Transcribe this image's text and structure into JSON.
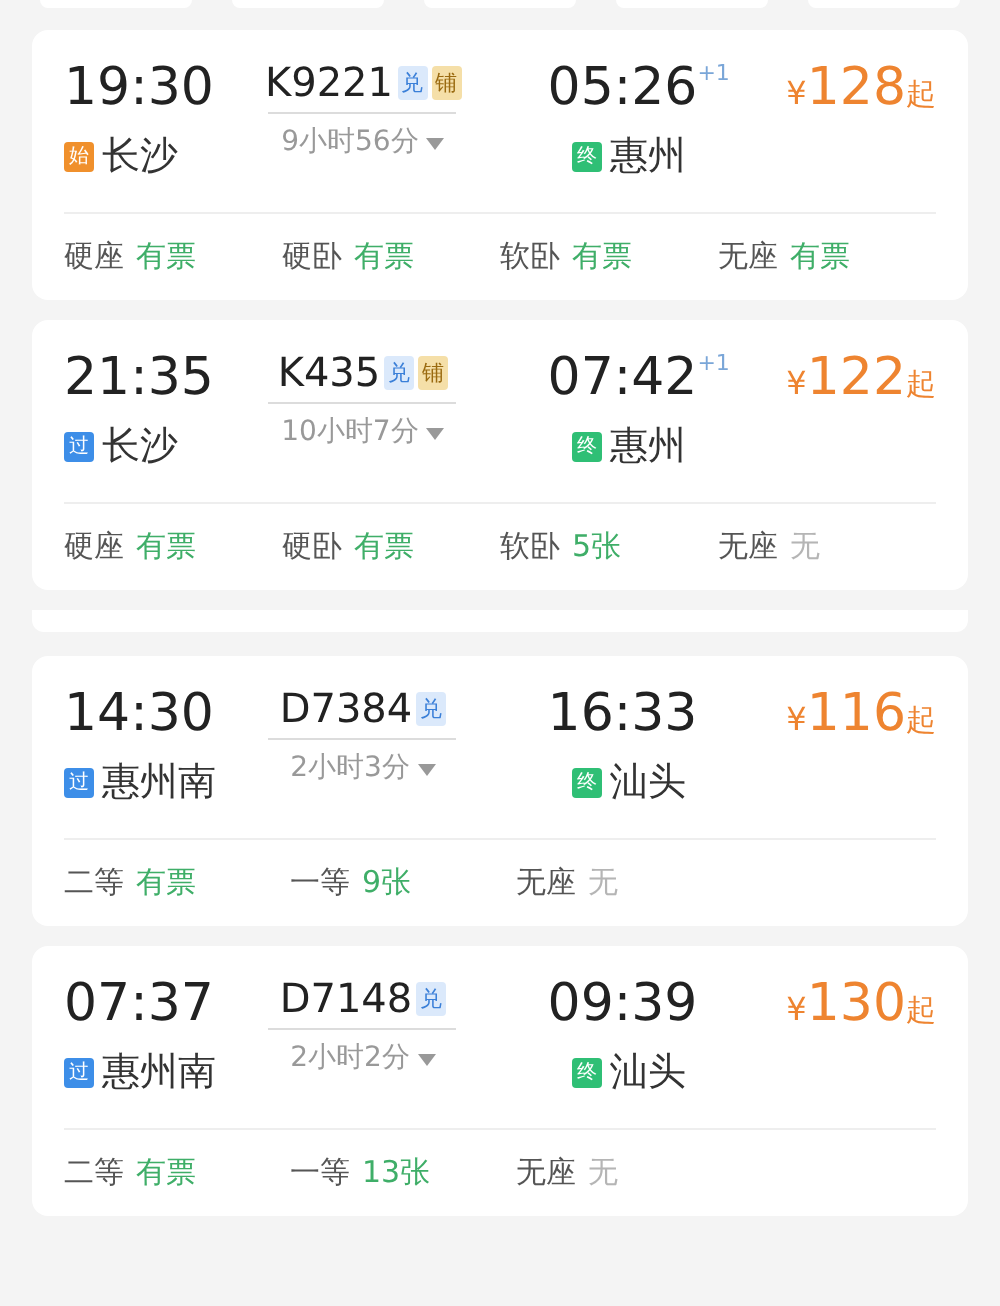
{
  "trains": [
    {
      "depart": "19:30",
      "from": {
        "kind": "start",
        "badge": "始",
        "name": "长沙"
      },
      "number": "K9221",
      "tags": [
        {
          "kind": "exchange",
          "text": "兑"
        },
        {
          "kind": "berth",
          "text": "铺"
        }
      ],
      "duration": "9小时56分",
      "arrive": "05:26",
      "next_day": "+1",
      "to": {
        "kind": "end",
        "badge": "终",
        "name": "惠州"
      },
      "currency": "¥",
      "price": "128",
      "price_suffix": "起",
      "seats": [
        {
          "name": "硬座",
          "status": "有票",
          "kind": "available"
        },
        {
          "name": "硬卧",
          "status": "有票",
          "kind": "available"
        },
        {
          "name": "软卧",
          "status": "有票",
          "kind": "available"
        },
        {
          "name": "无座",
          "status": "有票",
          "kind": "available"
        }
      ]
    },
    {
      "depart": "21:35",
      "from": {
        "kind": "pass",
        "badge": "过",
        "name": "长沙"
      },
      "number": "K435",
      "tags": [
        {
          "kind": "exchange",
          "text": "兑"
        },
        {
          "kind": "berth",
          "text": "铺"
        }
      ],
      "duration": "10小时7分",
      "arrive": "07:42",
      "next_day": "+1",
      "to": {
        "kind": "end",
        "badge": "终",
        "name": "惠州"
      },
      "currency": "¥",
      "price": "122",
      "price_suffix": "起",
      "seats": [
        {
          "name": "硬座",
          "status": "有票",
          "kind": "available"
        },
        {
          "name": "硬卧",
          "status": "有票",
          "kind": "available"
        },
        {
          "name": "软卧",
          "status": "5张",
          "kind": "available"
        },
        {
          "name": "无座",
          "status": "无",
          "kind": "none"
        }
      ]
    },
    {
      "kind": "divider"
    },
    {
      "depart": "14:30",
      "from": {
        "kind": "pass",
        "badge": "过",
        "name": "惠州南"
      },
      "number": "D7384",
      "tags": [
        {
          "kind": "exchange",
          "text": "兑"
        }
      ],
      "duration": "2小时3分",
      "arrive": "16:33",
      "to": {
        "kind": "end",
        "badge": "终",
        "name": "汕头"
      },
      "currency": "¥",
      "price": "116",
      "price_suffix": "起",
      "seats": [
        {
          "name": "二等",
          "status": "有票",
          "kind": "available"
        },
        {
          "name": "一等",
          "status": "9张",
          "kind": "available"
        },
        {
          "name": "无座",
          "status": "无",
          "kind": "none"
        }
      ]
    },
    {
      "depart": "07:37",
      "from": {
        "kind": "pass",
        "badge": "过",
        "name": "惠州南"
      },
      "number": "D7148",
      "tags": [
        {
          "kind": "exchange",
          "text": "兑"
        }
      ],
      "duration": "2小时2分",
      "arrive": "09:39",
      "to": {
        "kind": "end",
        "badge": "终",
        "name": "汕头"
      },
      "currency": "¥",
      "price": "130",
      "price_suffix": "起",
      "seats": [
        {
          "name": "二等",
          "status": "有票",
          "kind": "available"
        },
        {
          "name": "一等",
          "status": "13张",
          "kind": "available"
        },
        {
          "name": "无座",
          "status": "无",
          "kind": "none"
        }
      ]
    }
  ]
}
